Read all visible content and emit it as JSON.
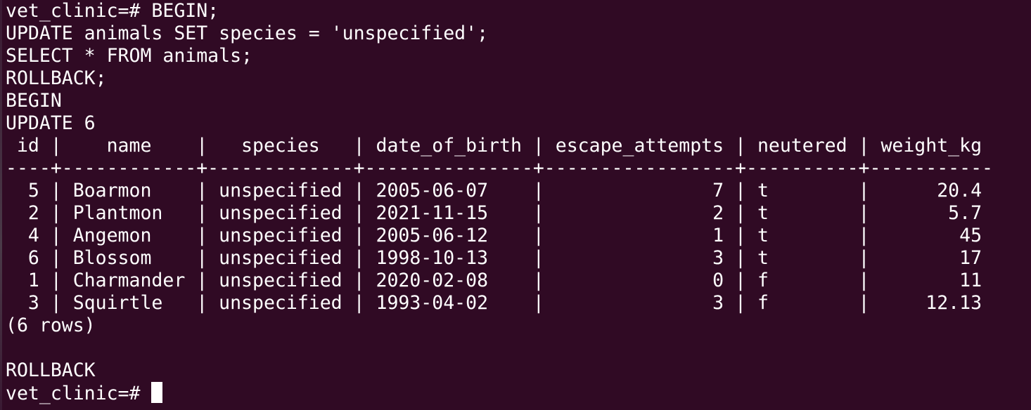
{
  "terminal": {
    "command_lines": [
      "vet_clinic=# BEGIN;",
      "UPDATE animals SET species = 'unspecified';",
      "SELECT * FROM animals;",
      "ROLLBACK;"
    ],
    "output_lines": [
      "BEGIN",
      "UPDATE 6"
    ],
    "table": {
      "header": " id |    name    |   species   | date_of_birth | escape_attempts | neutered | weight_kg",
      "separator": "----+------------+-------------+---------------+-----------------+----------+-----------",
      "rows": [
        "  5 | Boarmon    | unspecified | 2005-06-07    |               7 | t        |      20.4",
        "  2 | Plantmon   | unspecified | 2021-11-15    |               2 | t        |       5.7",
        "  4 | Angemon    | unspecified | 2005-06-12    |               1 | t        |        45",
        "  6 | Blossom    | unspecified | 1998-10-13    |               3 | t        |        17",
        "  1 | Charmander | unspecified | 2020-02-08    |               0 | f        |        11",
        "  3 | Squirtle   | unspecified | 1993-04-02    |               3 | f        |     12.13"
      ],
      "row_count": "(6 rows)"
    },
    "blank_line": "",
    "rollback_output": "ROLLBACK",
    "prompt": "vet_clinic=# "
  },
  "colors": {
    "background": "#300a24",
    "foreground": "#ffffff"
  }
}
